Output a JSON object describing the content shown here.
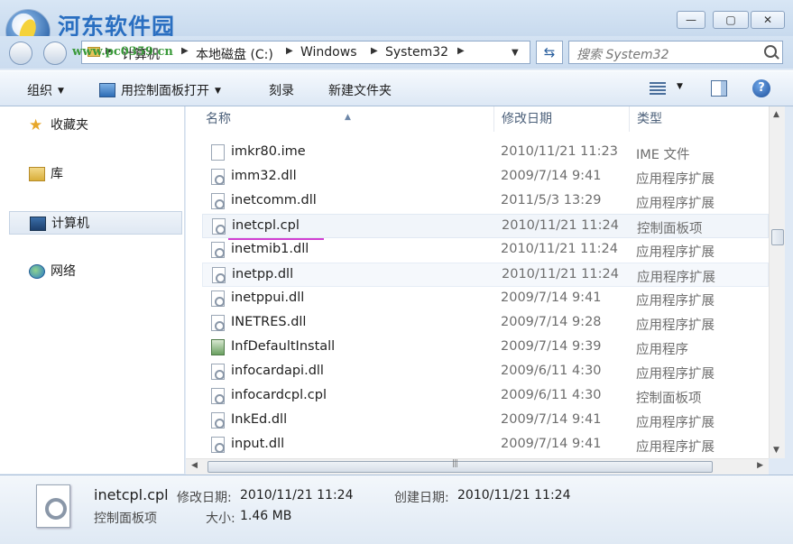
{
  "watermark": {
    "site_name": "河东软件园",
    "url": "www.pc0359.cn"
  },
  "window_controls": {
    "minimize": "—",
    "maximize": "▢",
    "close": "✕"
  },
  "address": {
    "crumbs": [
      "计算机",
      "本地磁盘 (C:)",
      "Windows",
      "System32"
    ],
    "search_placeholder": "搜索 System32"
  },
  "toolbar": {
    "organize": "组织",
    "open_with": "用控制面板打开",
    "burn": "刻录",
    "new_folder": "新建文件夹"
  },
  "nav": {
    "favorites": "收藏夹",
    "libraries": "库",
    "computer": "计算机",
    "network": "网络"
  },
  "columns": {
    "name": "名称",
    "date": "修改日期",
    "type": "类型"
  },
  "files": [
    {
      "name": "imkr80.ime",
      "date": "2010/11/21 11:23",
      "type": "IME 文件"
    },
    {
      "name": "imm32.dll",
      "date": "2009/7/14 9:41",
      "type": "应用程序扩展"
    },
    {
      "name": "inetcomm.dll",
      "date": "2011/5/3 13:29",
      "type": "应用程序扩展"
    },
    {
      "name": "inetcpl.cpl",
      "date": "2010/11/21 11:24",
      "type": "控制面板项"
    },
    {
      "name": "inetmib1.dll",
      "date": "2010/11/21 11:24",
      "type": "应用程序扩展"
    },
    {
      "name": "inetpp.dll",
      "date": "2010/11/21 11:24",
      "type": "应用程序扩展"
    },
    {
      "name": "inetppui.dll",
      "date": "2009/7/14 9:41",
      "type": "应用程序扩展"
    },
    {
      "name": "INETRES.dll",
      "date": "2009/7/14 9:28",
      "type": "应用程序扩展"
    },
    {
      "name": "InfDefaultInstall",
      "date": "2009/7/14 9:39",
      "type": "应用程序"
    },
    {
      "name": "infocardapi.dll",
      "date": "2009/6/11 4:30",
      "type": "应用程序扩展"
    },
    {
      "name": "infocardcpl.cpl",
      "date": "2009/6/11 4:30",
      "type": "控制面板项"
    },
    {
      "name": "InkEd.dll",
      "date": "2009/7/14 9:41",
      "type": "应用程序扩展"
    },
    {
      "name": "input.dll",
      "date": "2009/7/14 9:41",
      "type": "应用程序扩展"
    }
  ],
  "details": {
    "name": "inetcpl.cpl",
    "type": "控制面板项",
    "modified_label": "修改日期:",
    "modified_value": "2010/11/21 11:24",
    "created_label": "创建日期:",
    "created_value": "2010/11/21 11:24",
    "size_label": "大小:",
    "size_value": "1.46 MB"
  }
}
